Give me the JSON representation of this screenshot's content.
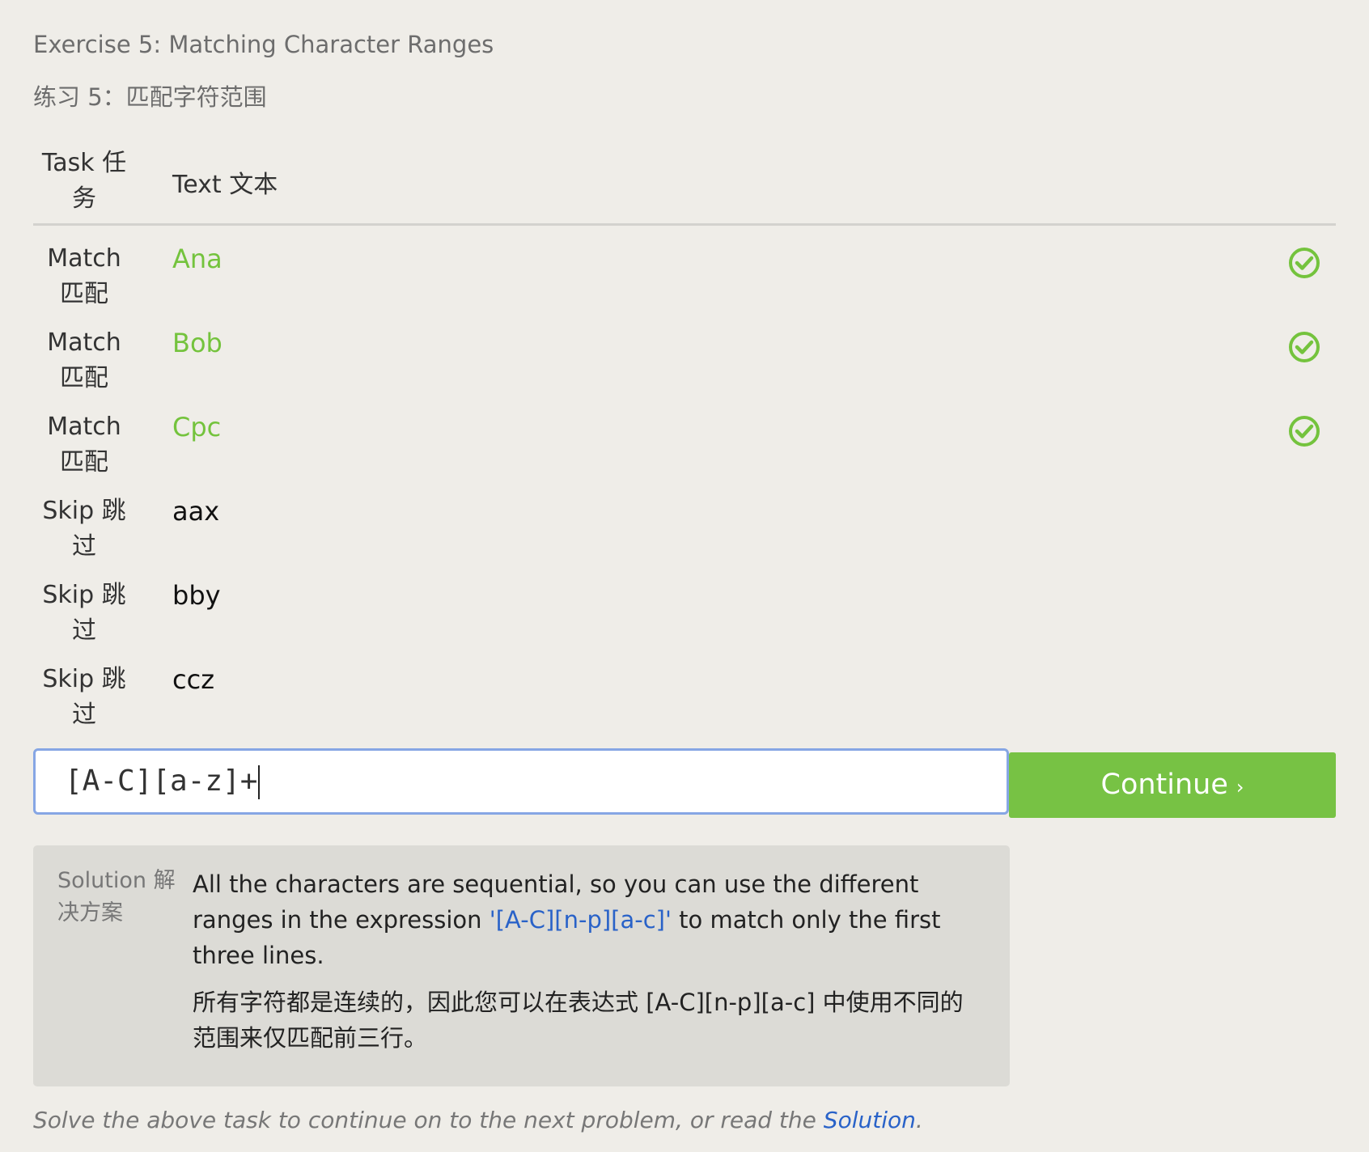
{
  "header": {
    "title_en": "Exercise 5: Matching Character Ranges",
    "title_zh": "练习 5：匹配字符范围"
  },
  "table": {
    "col_task": "Task 任务",
    "col_text": "Text 文本",
    "rows": [
      {
        "task": "Match 匹配",
        "text": "Ana",
        "status": "check-icon"
      },
      {
        "task": "Match 匹配",
        "text": "Bob",
        "status": "check-icon"
      },
      {
        "task": "Match 匹配",
        "text": "Cpc",
        "status": "check-icon"
      },
      {
        "task": "Skip 跳过",
        "text": "aax",
        "status": ""
      },
      {
        "task": "Skip 跳过",
        "text": "bby",
        "status": ""
      },
      {
        "task": "Skip 跳过",
        "text": "ccz",
        "status": ""
      }
    ]
  },
  "input": {
    "value": "[A-C][a-z]+"
  },
  "continue_button": {
    "label": "Continue",
    "chevron": "›"
  },
  "solution": {
    "label": "Solution 解决方案",
    "en_before": "All the characters are sequential, so you can use the different ranges in the expression ",
    "en_code": "'[A-C][n-p][a-c]'",
    "en_after": " to match only the first three lines.",
    "zh": "所有字符都是连续的，因此您可以在表达式 [A-C][n-p][a-c] 中使用不同的范围来仅匹配前三行。"
  },
  "footer": {
    "text": "Solve the above task to continue on to the next problem, or read the ",
    "link": "Solution",
    "end": "."
  },
  "colors": {
    "match_text": "#74c33d",
    "continue_bg": "#77c244",
    "link": "#2962c8",
    "input_border": "#86a6e4"
  }
}
